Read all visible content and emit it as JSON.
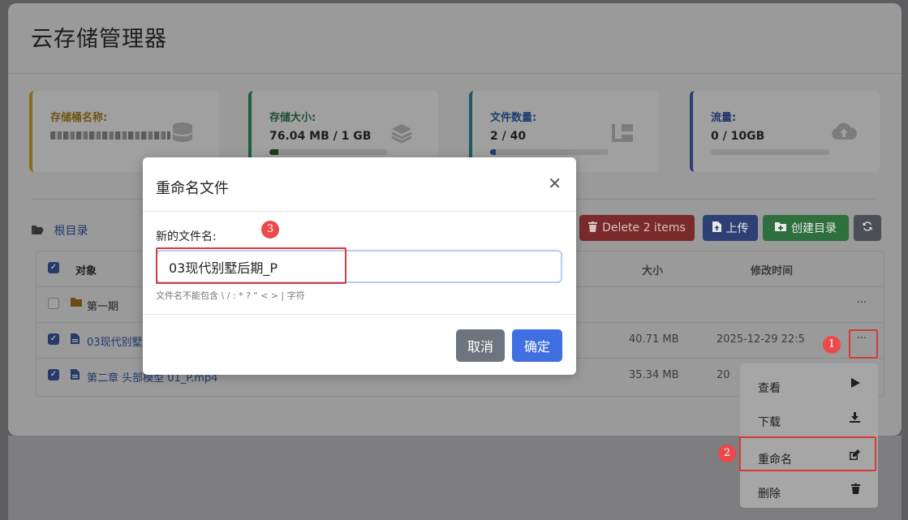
{
  "app": {
    "title": "云存储管理器"
  },
  "cards": [
    {
      "label": "存储桶名称:",
      "value": "",
      "value_blurred": true,
      "icon": "database-icon",
      "accent": "#8a6d1a",
      "progress": null
    },
    {
      "label": "存储大小:",
      "value": "76.04 MB / 1 GB",
      "icon": "layers-icon",
      "accent": "#1d5c3e",
      "progress": 0.074
    },
    {
      "label": "文件数量:",
      "value": "2 / 40",
      "icon": "folder-tree-icon",
      "accent": "#1f5c5f",
      "progress": 0.05
    },
    {
      "label": "流量:",
      "value": "0 / 10GB",
      "icon": "cloud-upload-icon",
      "accent": "#2b3f74",
      "progress": 0
    }
  ],
  "breadcrumb": {
    "root": "根目录"
  },
  "toolbar": {
    "delete": "Delete 2 items",
    "upload": "上传",
    "mkdir": "创建目录"
  },
  "table": {
    "headers": {
      "object": "对象",
      "size": "大小",
      "modified": "修改时间"
    },
    "rows": [
      {
        "name": "第一期",
        "type": "folder",
        "checked": false,
        "size": "",
        "time": ""
      },
      {
        "name": "03现代别墅后期_P.mp4",
        "type": "file",
        "checked": true,
        "size": "40.71 MB",
        "time": "2025-12-29 22:5"
      },
      {
        "name": "第二章 头部模型 01_P.mp4",
        "type": "file",
        "checked": true,
        "size": "35.34 MB",
        "time": "20"
      }
    ]
  },
  "context_menu": [
    {
      "label": "查看",
      "icon": "play-icon"
    },
    {
      "label": "下载",
      "icon": "download-icon"
    },
    {
      "label": "重命名",
      "icon": "edit-icon"
    },
    {
      "label": "删除",
      "icon": "trash-icon"
    }
  ],
  "annotations": {
    "step1": "1",
    "step2": "2",
    "step3": "3"
  },
  "modal": {
    "title": "重命名文件",
    "label": "新的文件名:",
    "value": "03现代别墅后期_P",
    "hint": "文件名不能包含 \\ / : * ? \" < > | 字符",
    "cancel": "取消",
    "ok": "确定"
  }
}
